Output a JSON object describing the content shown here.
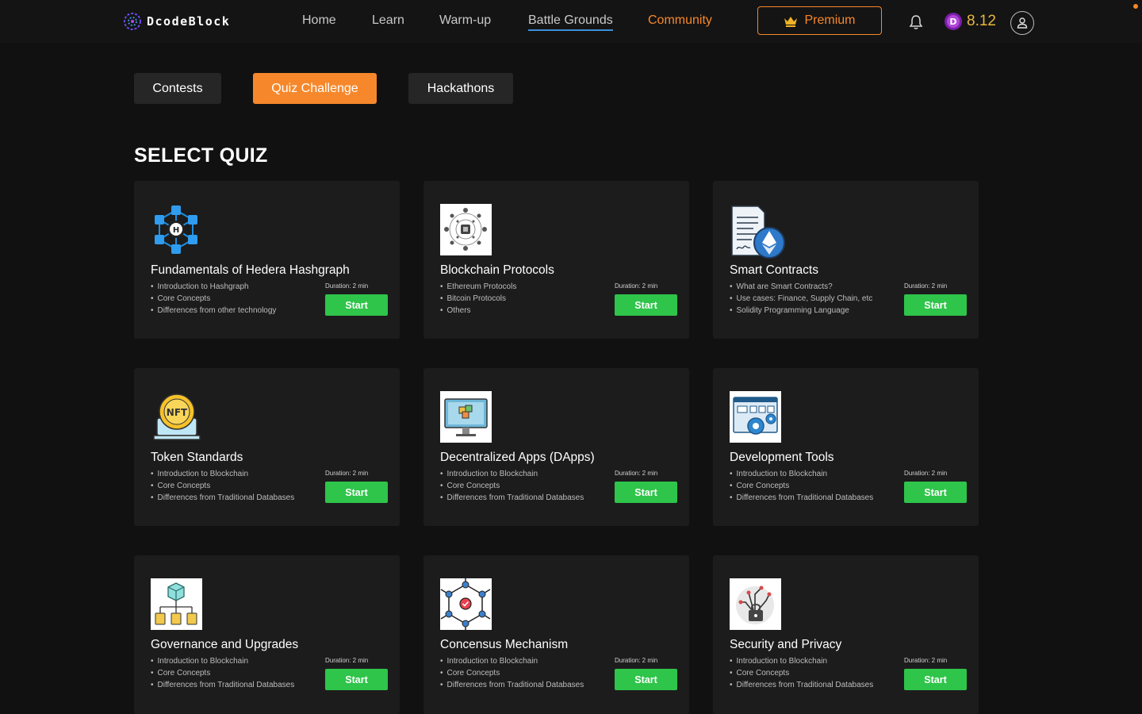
{
  "header": {
    "logo_text": "DcodeBlock",
    "nav": [
      {
        "label": "Home"
      },
      {
        "label": "Learn"
      },
      {
        "label": "Warm-up"
      },
      {
        "label": "Battle Grounds"
      },
      {
        "label": "Community"
      }
    ],
    "premium_label": "Premium",
    "coin_value": "8.12",
    "icons": [
      "crown-icon",
      "bell-icon",
      "coin-icon",
      "user-icon"
    ],
    "colors": {
      "accent": "#f6882b",
      "active_underline": "#3d8fd8",
      "coin": "#e8b83a"
    }
  },
  "tabs": [
    {
      "label": "Contests"
    },
    {
      "label": "Quiz Challenge",
      "active": true
    },
    {
      "label": "Hackathons"
    }
  ],
  "section_title": "SELECT QUIZ",
  "quizzes": [
    {
      "title": "Fundamentals of Hedera Hashgraph",
      "bullets": [
        "Introduction to Hashgraph",
        "Core Concepts",
        "Differences from other technology"
      ],
      "duration": "Duration: 2 min",
      "button": "Start",
      "icon": "hedera-network-icon"
    },
    {
      "title": "Blockchain Protocols",
      "bullets": [
        "Ethereum Protocols",
        "Bitcoin Protocols",
        "Others"
      ],
      "duration": "Duration: 2 min",
      "button": "Start",
      "icon": "blockchain-protocol-icon"
    },
    {
      "title": "Smart Contracts",
      "bullets": [
        "What are Smart Contracts?",
        "Use cases: Finance, Supply Chain, etc",
        "Solidity Programming Language"
      ],
      "duration": "Duration: 2 min",
      "button": "Start",
      "icon": "smart-contract-icon"
    },
    {
      "title": "Token Standards",
      "bullets": [
        "Introduction to Blockchain",
        "Core Concepts",
        "Differences from Traditional Databases"
      ],
      "duration": "Duration: 2 min",
      "button": "Start",
      "icon": "nft-token-icon"
    },
    {
      "title": "Decentralized Apps (DApps)",
      "bullets": [
        "Introduction to Blockchain",
        "Core Concepts",
        "Differences from Traditional Databases"
      ],
      "duration": "Duration: 2 min",
      "button": "Start",
      "icon": "dapp-monitor-icon"
    },
    {
      "title": "Development Tools",
      "bullets": [
        "Introduction to Blockchain",
        "Core Concepts",
        "Differences from Traditional Databases"
      ],
      "duration": "Duration: 2 min",
      "button": "Start",
      "icon": "dev-tools-gear-icon"
    },
    {
      "title": "Governance and Upgrades",
      "bullets": [
        "Introduction to Blockchain",
        "Core Concepts",
        "Differences from Traditional Databases"
      ],
      "duration": "Duration: 2 min",
      "button": "Start",
      "icon": "governance-hierarchy-icon"
    },
    {
      "title": "Concensus Mechanism",
      "bullets": [
        "Introduction to Blockchain",
        "Core Concepts",
        "Differences from Traditional Databases"
      ],
      "duration": "Duration: 2 min",
      "button": "Start",
      "icon": "consensus-network-icon"
    },
    {
      "title": "Security and Privacy",
      "bullets": [
        "Introduction to Blockchain",
        "Core Concepts",
        "Differences from Traditional Databases"
      ],
      "duration": "Duration: 2 min",
      "button": "Start",
      "icon": "security-chip-icon"
    }
  ]
}
